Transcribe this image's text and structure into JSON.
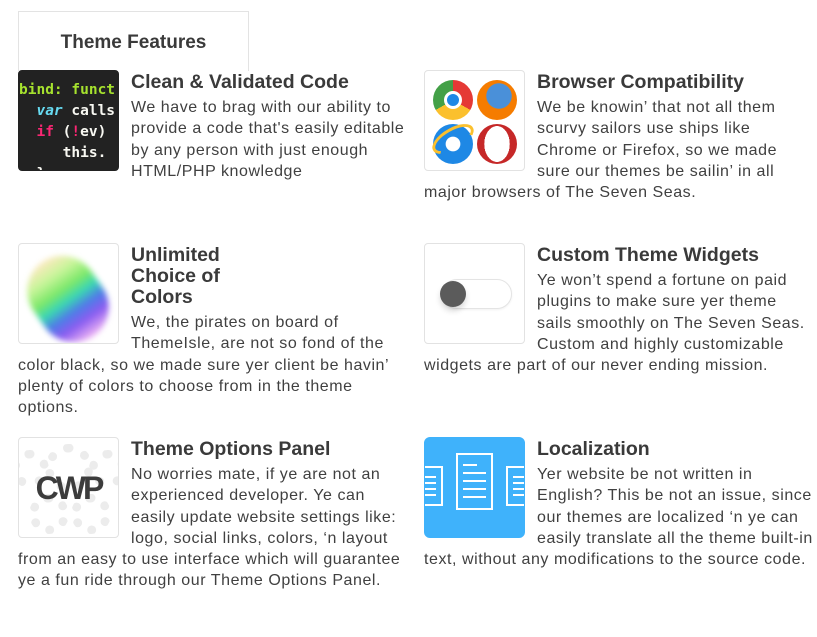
{
  "tab": {
    "label": "Theme Features"
  },
  "features": [
    {
      "title": "Clean & Validated Code",
      "text": "We have to brag with our ability to provide a code that's easily editable by any person with just enough HTML/PHP knowledge",
      "icon": "code-snippet-icon",
      "code_lines": [
        "bind: funct",
        "  var calls",
        "  if (!ev)",
        "     this.",
        "  }"
      ]
    },
    {
      "title": "Browser Compatibility",
      "text": "We be knowin’ that not all them scurvy sailors use ships like Chrome or Firefox, so we made sure our themes be sailin’ in all major browsers of The Seven Seas.",
      "icon": "browsers-icon"
    },
    {
      "title": "Unlimited Choice of Colors",
      "text": "We, the pirates on board of ThemeIsle, are not so fond of the color black, so we made sure yer client be havin’ plenty of colors to choose from in the theme options.",
      "icon": "color-palette-icon"
    },
    {
      "title": "Custom Theme Widgets",
      "text": "Ye won’t spend a fortune on paid plugins to make sure yer theme sails smoothly on The Seven Seas. Custom and highly customizable widgets are part of our never ending mission.",
      "icon": "toggle-switch-icon"
    },
    {
      "title": "Theme Options Panel",
      "text": "No worries mate, if ye are not an experienced developer. Ye can easily update website settings like: logo, social links, colors, ‘n layout from an easy to use interface which will guarantee ye a fun ride through our Theme Options Panel.",
      "icon": "cwp-logo-icon",
      "logo_text": "CWP"
    },
    {
      "title": "Localization",
      "text": "Yer website be not written in English? This be not an issue, since our themes are localized ‘n ye can easily translate all the theme built-in text, without any modifications to the source code.",
      "icon": "documents-icon"
    }
  ],
  "colors": {
    "heading": "#3a3a3a",
    "body_text": "#404040",
    "localization_bg": "#3fb2fb",
    "code_bg": "#222222"
  }
}
